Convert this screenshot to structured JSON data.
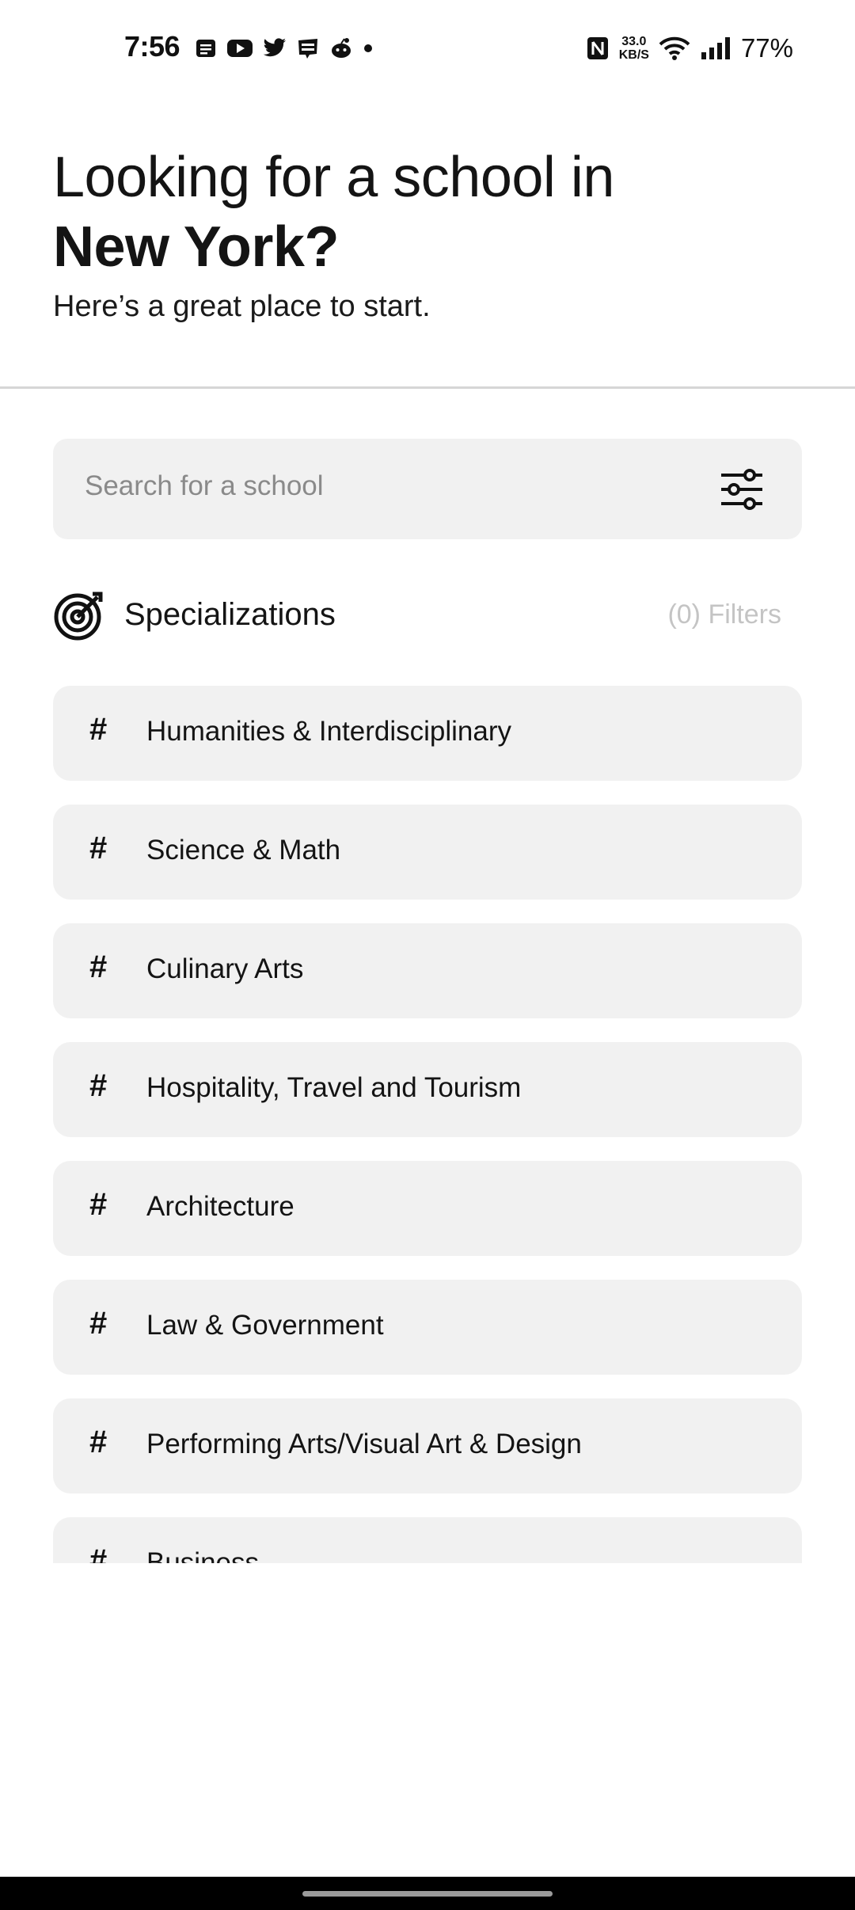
{
  "status_bar": {
    "time": "7:56",
    "notification_icons": [
      "messages-icon",
      "youtube-icon",
      "twitter-icon",
      "webtoon-icon",
      "reddit-icon",
      "more-dot-icon"
    ],
    "network_speed_value": "33.0",
    "network_speed_unit": "KB/S",
    "battery": "77%"
  },
  "hero": {
    "line1": "Looking for a school in",
    "line2": "New York?",
    "subtitle": "Here’s a great place to start."
  },
  "search": {
    "placeholder": "Search for a school"
  },
  "specializations": {
    "title": "Specializations",
    "filters_label": "(0) Filters",
    "items": [
      {
        "hash": "#",
        "label": "Humanities & Interdisciplinary"
      },
      {
        "hash": "#",
        "label": "Science & Math"
      },
      {
        "hash": "#",
        "label": "Culinary Arts"
      },
      {
        "hash": "#",
        "label": "Hospitality, Travel and Tourism"
      },
      {
        "hash": "#",
        "label": "Architecture"
      },
      {
        "hash": "#",
        "label": "Law & Government"
      },
      {
        "hash": "#",
        "label": "Performing Arts/Visual Art & Design"
      },
      {
        "hash": "#",
        "label": "Business"
      }
    ]
  },
  "colors": {
    "card_background": "#f1f1f1",
    "muted_text": "#8a8a8a",
    "filters_text": "#c4c4c4",
    "divider": "#d6d6d6"
  }
}
